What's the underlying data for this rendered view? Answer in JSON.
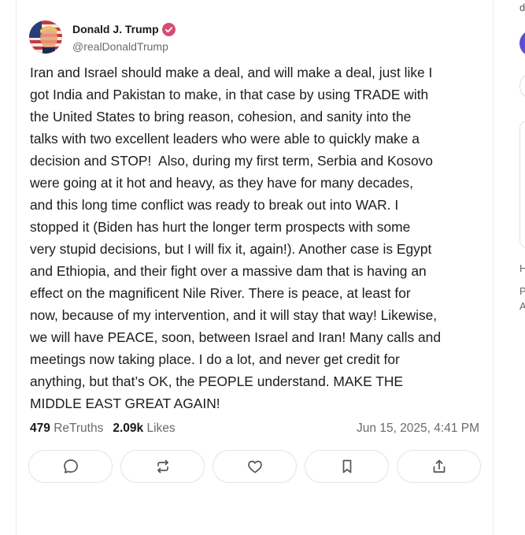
{
  "post": {
    "author_name": "Donald J. Trump",
    "author_handle": "@realDonaldTrump",
    "verified_color": "#d64c74",
    "body": "Iran and Israel should make a deal, and will make a deal, just like I\ngot India and Pakistan to make, in that case by using TRADE with\nthe United States to bring reason, cohesion, and sanity into the\ntalks with two excellent leaders who were able to quickly make a\ndecision and STOP!  Also, during my first term, Serbia and Kosovo\nwere going at it hot and heavy, as they have for many decades,\nand this long time conflict was ready to break out into WAR. I\nstopped it (Biden has hurt the longer term prospects with some\nvery stupid decisions, but I will fix it, again!). Another case is Egypt\nand Ethiopia, and their fight over a massive dam that is having an\neffect on the magnificent Nile River. There is peace, at least for\nnow, because of my intervention, and it will stay that way! Likewise,\nwe will have PEACE, soon, between Israel and Iran! Many calls and\nmeetings now taking place. I do a lot, and never get credit for\nanything, but that’s OK, the PEOPLE understand. MAKE THE\nMIDDLE EAST GREAT AGAIN!",
    "retruths_count": "479",
    "retruths_label": "ReTruths",
    "likes_count": "2.09k",
    "likes_label": "Likes",
    "timestamp": "Jun 15, 2025, 4:41 PM"
  },
  "actions": [
    {
      "icon": "reply-icon"
    },
    {
      "icon": "retruth-icon"
    },
    {
      "icon": "like-icon"
    },
    {
      "icon": "bookmark-icon"
    },
    {
      "icon": "share-icon"
    }
  ],
  "sidebar": {
    "top_text": "d",
    "accent_color": "#5b4fd6",
    "letter_1": "H",
    "letter_2": "P",
    "letter_3": "A"
  }
}
